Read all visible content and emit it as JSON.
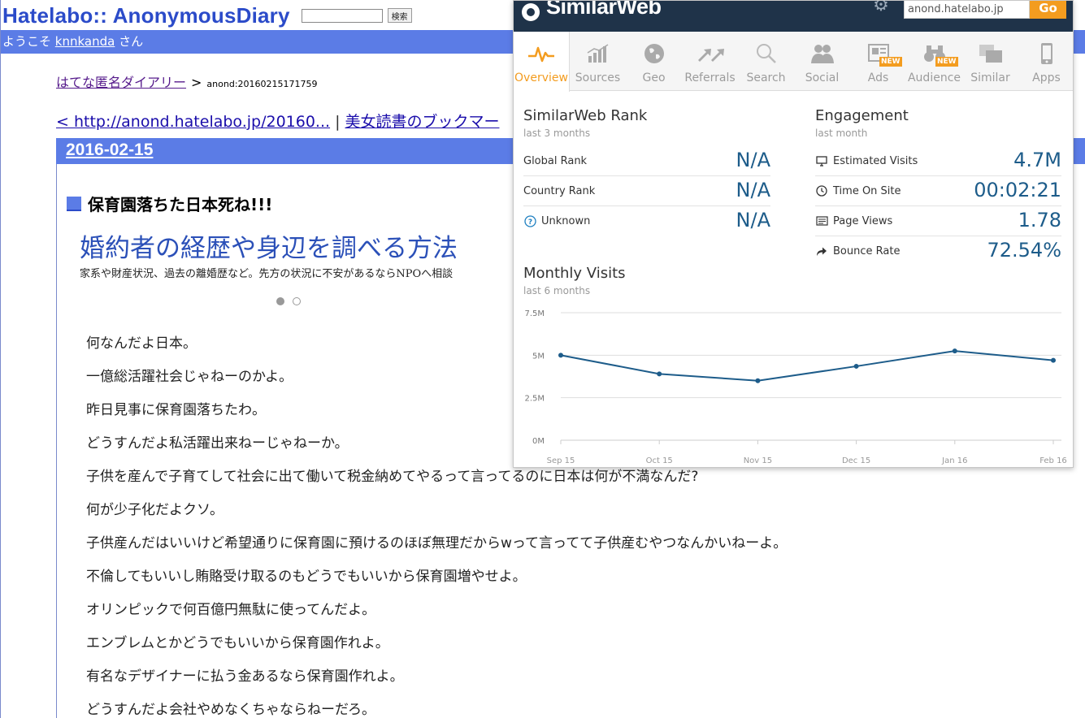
{
  "site": {
    "logo": "Hatelabo:: AnonymousDiary",
    "search_button": "検索",
    "welcome_prefix": "ようこそ",
    "username": "knnkanda",
    "welcome_suffix": "さん"
  },
  "breadcrumb": {
    "home": "はてな匿名ダイアリー",
    "separator": ">",
    "current": "anond:20160215171759"
  },
  "entry_nav": {
    "prev_link": "< http://anond.hatelabo.jp/20160...",
    "separator": "|",
    "next_link": "美女読書のブックマー"
  },
  "entry": {
    "date": "2016-02-15",
    "title": "保育園落ちた日本死ね!!!",
    "paragraphs": [
      "何なんだよ日本。",
      "一億総活躍社会じゃねーのかよ。",
      "昨日見事に保育園落ちたわ。",
      "どうすんだよ私活躍出来ねーじゃねーか。",
      "子供を産んで子育てして社会に出て働いて税金納めてやるって言ってるのに日本は何が不満なんだ?",
      "何が少子化だよクソ。",
      "子供産んだはいいけど希望通りに保育園に預けるのほぼ無理だからwって言ってて子供産むやつなんかいねーよ。",
      "不倫してもいいし賄賂受け取るのもどうでもいいから保育園増やせよ。",
      "オリンピックで何百億円無駄に使ってんだよ。",
      "エンブレムとかどうでもいいから保育園作れよ。",
      "有名なデザイナーに払う金あるなら保育園作れよ。",
      "どうすんだよ会社やめなくちゃならねーだろ。"
    ]
  },
  "ad": {
    "title": "婚約者の経歴や身辺を調べる方法",
    "description": "家系や財産状況、過去の離婚歴など。先方の状況に不安があるならNPOへ相談"
  },
  "similarweb": {
    "brand": "SimilarWeb",
    "domain_value": "anond.hatelabo.jp",
    "go_label": "Go",
    "accent_color": "#f39c1f",
    "header_color": "#1f3349",
    "value_color": "#1d5c8a",
    "tabs": [
      {
        "label": "Overview",
        "icon": "pulse-icon",
        "active": true
      },
      {
        "label": "Sources",
        "icon": "bar-chart-icon"
      },
      {
        "label": "Geo",
        "icon": "globe-icon"
      },
      {
        "label": "Referrals",
        "icon": "arrows-icon"
      },
      {
        "label": "Search",
        "icon": "magnifier-icon"
      },
      {
        "label": "Social",
        "icon": "people-icon"
      },
      {
        "label": "Ads",
        "icon": "ads-icon",
        "badge": "NEW"
      },
      {
        "label": "Audience",
        "icon": "binoculars-icon",
        "badge": "NEW"
      },
      {
        "label": "Similar",
        "icon": "windows-icon"
      },
      {
        "label": "Apps",
        "icon": "phone-icon"
      }
    ],
    "rank": {
      "title": "SimilarWeb Rank",
      "period": "last 3 months",
      "rows": [
        {
          "label": "Global Rank",
          "value": "N/A"
        },
        {
          "label": "Country Rank",
          "value": "N/A"
        },
        {
          "label": "Unknown",
          "value": "N/A",
          "icon": "question-circle-icon"
        }
      ]
    },
    "engagement": {
      "title": "Engagement",
      "period": "last month",
      "rows": [
        {
          "label": "Estimated Visits",
          "value": "4.7M",
          "icon": "monitor-icon"
        },
        {
          "label": "Time On Site",
          "value": "00:02:21",
          "icon": "clock-icon"
        },
        {
          "label": "Page Views",
          "value": "1.78",
          "icon": "pages-icon"
        },
        {
          "label": "Bounce Rate",
          "value": "72.54%",
          "icon": "bounce-arrow-icon"
        }
      ]
    },
    "monthly": {
      "title": "Monthly Visits",
      "period": "last 6 months"
    }
  },
  "chart_data": {
    "type": "line",
    "title": "Monthly Visits",
    "categories": [
      "Sep 15",
      "Oct 15",
      "Nov 15",
      "Dec 15",
      "Jan 16",
      "Feb 16"
    ],
    "series": [
      {
        "values": [
          5.0,
          3.9,
          3.5,
          4.35,
          5.25,
          4.7
        ]
      }
    ],
    "yticks": [
      "7.5M",
      "5M",
      "2.5M",
      "0M"
    ],
    "ytick_values": [
      7.5,
      5,
      2.5,
      0
    ],
    "ylim": [
      0,
      7.5
    ],
    "units": "M",
    "grid": true,
    "line_color": "#1d5c8a"
  }
}
